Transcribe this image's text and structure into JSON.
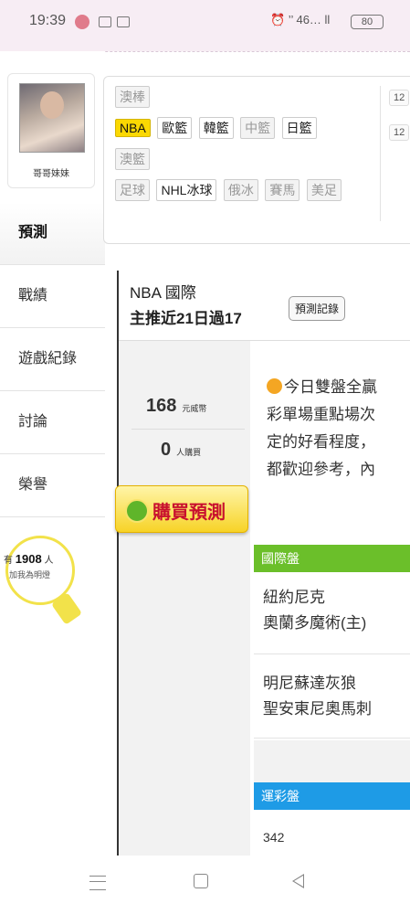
{
  "status_bar": {
    "time": "19:39",
    "indicators": "⏰ ’’ 46… ll",
    "battery": "80"
  },
  "profile": {
    "name": "哥哥妹妹"
  },
  "menu": [
    {
      "label": "預測"
    },
    {
      "label": "戰績"
    },
    {
      "label": "遊戲紀錄"
    },
    {
      "label": "討論"
    },
    {
      "label": "榮譽"
    }
  ],
  "light_widget": {
    "prefix": "有",
    "count": "1908",
    "suffix": "人",
    "text": "加我為明燈"
  },
  "categories": {
    "row1": [
      "澳棒"
    ],
    "row2": [
      "NBA",
      "歐籃",
      "韓籃",
      "中籃",
      "日籃"
    ],
    "row3": [
      "澳籃"
    ],
    "row4": [
      "足球",
      "NHL冰球",
      "俄冰",
      "賽馬",
      "美足"
    ],
    "dates": [
      "12",
      "12"
    ]
  },
  "header": {
    "league": "NBA 國際",
    "record": "主推近21日過17",
    "history_button": "預測記錄"
  },
  "purchase": {
    "price": "168",
    "price_unit": "元威幣",
    "buyers": "0",
    "buyers_unit": "人購買",
    "buy_button": "購買預測"
  },
  "description": [
    "今日雙盤全贏",
    "彩單場重點場次",
    "定的好看程度，",
    "都歡迎參考，內"
  ],
  "section_international": {
    "title": "國際盤",
    "games": [
      {
        "away": "紐約尼克",
        "home": "奧蘭多魔術(主)"
      },
      {
        "away": "明尼蘇達灰狼",
        "home": "聖安東尼奧馬刺"
      }
    ]
  },
  "section_sportslottery": {
    "title": "運彩盤",
    "first_code": "342"
  },
  "colors": {
    "intl_bar": "#6bbf2a",
    "lottery_bar": "#1e9be6",
    "buy_text": "#c8102e",
    "nba_tag": "#fbd802"
  }
}
